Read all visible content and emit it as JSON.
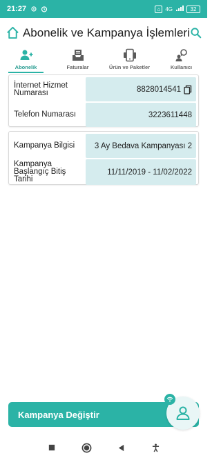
{
  "status_bar": {
    "time": "21:27",
    "network": "4G",
    "battery": "32"
  },
  "header": {
    "title": "Abonelik ve Kampanya İşlemleri"
  },
  "tabs": [
    {
      "label": "Abonelik",
      "icon": "add-user-icon",
      "active": true
    },
    {
      "label": "Faturalar",
      "icon": "invoice-tray-icon",
      "active": false
    },
    {
      "label": "Ürün ve Paketler",
      "icon": "devices-icon",
      "active": false
    },
    {
      "label": "Kullanıcı",
      "icon": "user-key-icon",
      "active": false
    }
  ],
  "subscription": {
    "rows": [
      {
        "label": "İnternet Hizmet Numarası",
        "value": "8828014541"
      },
      {
        "label": "Telefon Numarası",
        "value": "3223611448"
      }
    ]
  },
  "campaign": {
    "rows": [
      {
        "label": "Kampanya Bilgisi",
        "value": "3 Ay Bedava Kampanyası 2"
      },
      {
        "label": "Kampanya Başlangıç Bitiş Tarihi",
        "value": "11/11/2019 - 11/02/2022"
      }
    ]
  },
  "cta": {
    "label": "Kampanya Değiştir"
  },
  "colors": {
    "accent": "#2bb3a6",
    "value_bg": "#d5ecee"
  }
}
